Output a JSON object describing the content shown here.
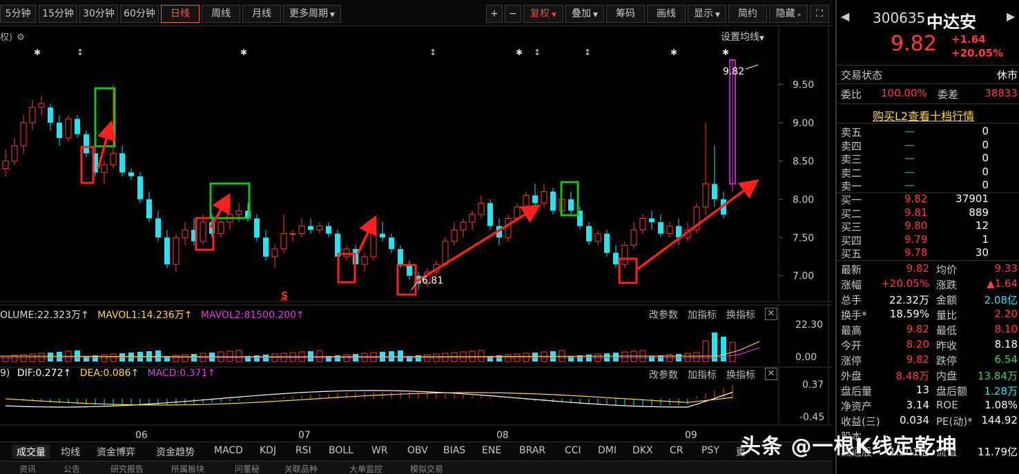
{
  "toolbar": {
    "periods": [
      "5分钟",
      "15分钟",
      "30分钟",
      "60分钟",
      "日线",
      "周线",
      "月线",
      "更多周期"
    ],
    "active_period": "日线",
    "plus": "+",
    "minus": "−",
    "fuquan": "复权",
    "overlay": "叠加",
    "chips": "筹码",
    "draw": "画线",
    "display": "显示",
    "simple": "简约",
    "hide": "隐藏",
    "fullscreen_icon": "fullscreen-icon"
  },
  "chart": {
    "left_label": "权)",
    "settings_label": "设置均线",
    "high_label": "9.82",
    "low_label": "6.81",
    "s_marker": "S",
    "markers": [
      "✱",
      "↕",
      "✱",
      "↕",
      "✱",
      "↕",
      "↕",
      "✱",
      "✱"
    ],
    "price_ticks": [
      "9.50",
      "9.00",
      "8.50",
      "8.00",
      "7.50",
      "7.00"
    ],
    "x_ticks": [
      "06",
      "07",
      "08",
      "09"
    ]
  },
  "chart_data": {
    "type": "candlestick",
    "price_axis": [
      6.7,
      9.9
    ],
    "ohlc": [
      [
        8.4,
        8.65,
        8.3,
        8.5
      ],
      [
        8.5,
        8.8,
        8.45,
        8.7
      ],
      [
        8.7,
        9.1,
        8.6,
        9.0
      ],
      [
        9.0,
        9.3,
        8.9,
        9.2
      ],
      [
        9.2,
        9.35,
        9.1,
        9.25
      ],
      [
        9.2,
        9.25,
        8.9,
        9.0
      ],
      [
        9.0,
        9.1,
        8.7,
        8.8
      ],
      [
        8.8,
        9.1,
        8.75,
        9.05
      ],
      [
        9.05,
        9.1,
        8.8,
        8.85
      ],
      [
        8.85,
        8.9,
        8.55,
        8.6
      ],
      [
        8.6,
        8.7,
        8.3,
        8.35
      ],
      [
        8.35,
        8.5,
        8.2,
        8.45
      ],
      [
        8.45,
        9.5,
        8.4,
        8.6
      ],
      [
        8.6,
        8.7,
        8.3,
        8.35
      ],
      [
        8.35,
        8.4,
        8.25,
        8.3
      ],
      [
        8.3,
        8.35,
        7.95,
        8.0
      ],
      [
        8.0,
        8.1,
        7.7,
        7.75
      ],
      [
        7.75,
        7.85,
        7.45,
        7.5
      ],
      [
        7.5,
        7.6,
        7.1,
        7.15
      ],
      [
        7.15,
        7.55,
        7.05,
        7.5
      ],
      [
        7.5,
        7.7,
        7.4,
        7.6
      ],
      [
        7.6,
        7.75,
        7.4,
        7.45
      ],
      [
        7.45,
        7.8,
        7.4,
        7.7
      ],
      [
        7.7,
        7.8,
        7.5,
        7.55
      ],
      [
        7.55,
        7.75,
        7.5,
        7.7
      ],
      [
        7.7,
        8.05,
        7.6,
        7.8
      ],
      [
        7.8,
        7.95,
        7.7,
        7.85
      ],
      [
        7.85,
        7.95,
        7.7,
        7.75
      ],
      [
        7.75,
        7.8,
        7.45,
        7.5
      ],
      [
        7.5,
        7.6,
        7.2,
        7.25
      ],
      [
        7.25,
        7.4,
        7.1,
        7.35
      ],
      [
        7.35,
        7.8,
        7.3,
        7.55
      ],
      [
        7.55,
        7.6,
        7.45,
        7.55
      ],
      [
        7.55,
        7.75,
        7.5,
        7.65
      ],
      [
        7.65,
        7.75,
        7.55,
        7.6
      ],
      [
        7.6,
        7.7,
        7.55,
        7.65
      ],
      [
        7.65,
        7.7,
        7.5,
        7.55
      ],
      [
        7.55,
        7.6,
        7.2,
        7.25
      ],
      [
        7.25,
        7.4,
        7.2,
        7.35
      ],
      [
        7.35,
        7.4,
        7.1,
        7.15
      ],
      [
        7.15,
        7.3,
        7.05,
        7.25
      ],
      [
        7.25,
        7.6,
        7.2,
        7.55
      ],
      [
        7.55,
        7.7,
        7.45,
        7.5
      ],
      [
        7.5,
        7.55,
        7.3,
        7.35
      ],
      [
        7.35,
        7.4,
        7.1,
        7.15
      ],
      [
        7.15,
        7.2,
        6.95,
        7.0
      ],
      [
        7.0,
        7.05,
        6.81,
        6.9
      ],
      [
        6.9,
        7.1,
        6.85,
        7.05
      ],
      [
        7.05,
        7.2,
        7.0,
        7.15
      ],
      [
        7.15,
        7.5,
        7.1,
        7.45
      ],
      [
        7.45,
        7.7,
        7.4,
        7.6
      ],
      [
        7.6,
        7.75,
        7.5,
        7.7
      ],
      [
        7.7,
        7.85,
        7.6,
        7.8
      ],
      [
        7.8,
        8.05,
        7.75,
        7.95
      ],
      [
        7.95,
        8.0,
        7.6,
        7.65
      ],
      [
        7.65,
        7.75,
        7.4,
        7.5
      ],
      [
        7.5,
        7.8,
        7.45,
        7.75
      ],
      [
        7.75,
        7.95,
        7.7,
        7.9
      ],
      [
        7.9,
        8.1,
        7.85,
        8.05
      ],
      [
        8.05,
        8.2,
        7.9,
        7.95
      ],
      [
        7.95,
        8.2,
        7.9,
        8.1
      ],
      [
        8.1,
        8.15,
        7.8,
        7.85
      ],
      [
        7.85,
        8.05,
        7.8,
        8.0
      ],
      [
        8.0,
        8.1,
        7.8,
        7.85
      ],
      [
        7.85,
        7.9,
        7.6,
        7.65
      ],
      [
        7.65,
        7.7,
        7.4,
        7.45
      ],
      [
        7.45,
        7.6,
        7.4,
        7.55
      ],
      [
        7.55,
        7.6,
        7.25,
        7.3
      ],
      [
        7.3,
        7.4,
        7.1,
        7.15
      ],
      [
        7.15,
        7.45,
        7.1,
        7.4
      ],
      [
        7.4,
        7.7,
        7.35,
        7.6
      ],
      [
        7.6,
        7.8,
        7.55,
        7.75
      ],
      [
        7.75,
        7.85,
        7.6,
        7.7
      ],
      [
        7.7,
        7.8,
        7.5,
        7.55
      ],
      [
        7.55,
        7.7,
        7.5,
        7.65
      ],
      [
        7.65,
        7.75,
        7.4,
        7.5
      ],
      [
        7.5,
        7.7,
        7.45,
        7.6
      ],
      [
        7.6,
        7.95,
        7.55,
        7.9
      ],
      [
        7.9,
        9.0,
        7.8,
        8.2
      ],
      [
        8.2,
        8.7,
        7.9,
        8.0
      ],
      [
        8.0,
        8.1,
        7.75,
        7.8
      ],
      [
        8.2,
        9.82,
        8.1,
        9.82
      ]
    ],
    "volume_axis": [
      "22.30",
      "0.00"
    ],
    "macd_axis": [
      "0.37",
      "-0.45"
    ]
  },
  "volume": {
    "label": "OLUME:22.323万↑",
    "mavol1": "MAVOL1:14.236万↑",
    "mavol2": "MAVOL2:81500.200↑",
    "tools": [
      "改参数",
      "加指标",
      "换指标"
    ]
  },
  "macd": {
    "label": "9)",
    "dif": "DIF:0.272↑",
    "dea": "DEA:0.086↑",
    "macd": "MACD:0.371↑",
    "tools": [
      "改参数",
      "加指标",
      "换指标"
    ]
  },
  "tabs": [
    "成交量",
    "均线",
    "资金博弈",
    "资金趋势",
    "MACD",
    "KDJ",
    "RSI",
    "BOLL",
    "WR",
    "OBV",
    "BIAS",
    "ENE",
    "BRAR",
    "CCI",
    "DMI",
    "DKX",
    "CR",
    "PSY",
    "更"
  ],
  "tabs2": [
    "资讯",
    "公告",
    "研究报告",
    "所属板块",
    "问董秘",
    "关联品种",
    "大单监控",
    "模拟交易"
  ],
  "quote": {
    "code": "300635",
    "name": "中达安",
    "price": "9.82",
    "change": "+1.64",
    "change_pct": "+20.05%",
    "status_label": "交易状态",
    "status_value": "休市",
    "weibi_label": "委比",
    "weibi_value": "100.00%",
    "weicha_label": "委差",
    "weicha_value": "38833",
    "l2_link": "购买L2查看十档行情",
    "asks": [
      {
        "label": "卖五",
        "price": "—",
        "vol": "0"
      },
      {
        "label": "卖四",
        "price": "—",
        "vol": "0"
      },
      {
        "label": "卖三",
        "price": "—",
        "vol": "0"
      },
      {
        "label": "卖二",
        "price": "—",
        "vol": "0"
      },
      {
        "label": "卖一",
        "price": "—",
        "vol": "0"
      }
    ],
    "bids": [
      {
        "label": "买一",
        "price": "9.82",
        "vol": "37901"
      },
      {
        "label": "买二",
        "price": "9.81",
        "vol": "889"
      },
      {
        "label": "买三",
        "price": "9.80",
        "vol": "12"
      },
      {
        "label": "买四",
        "price": "9.79",
        "vol": "1"
      },
      {
        "label": "买五",
        "price": "9.78",
        "vol": "30"
      }
    ],
    "stats": [
      {
        "l1": "最新",
        "v1": "9.82",
        "c1": "red",
        "l2": "均价",
        "v2": "9.33",
        "c2": "red"
      },
      {
        "l1": "涨幅",
        "v1": "+20.05%",
        "c1": "red",
        "l2": "涨跌",
        "v2": "▲1.64",
        "c2": "red"
      },
      {
        "l1": "总手",
        "v1": "22.32万",
        "c1": "white",
        "l2": "金额",
        "v2": "2.08亿",
        "c2": "cyan"
      },
      {
        "l1": "换手*",
        "v1": "18.59%",
        "c1": "white",
        "l2": "量比",
        "v2": "2.20",
        "c2": "red"
      },
      {
        "l1": "最高",
        "v1": "9.82",
        "c1": "red",
        "l2": "最低",
        "v2": "8.10",
        "c2": "red"
      },
      {
        "l1": "今开",
        "v1": "8.20",
        "c1": "red",
        "l2": "昨收",
        "v2": "8.18",
        "c2": "white"
      },
      {
        "l1": "涨停",
        "v1": "9.82",
        "c1": "red",
        "l2": "跌停",
        "v2": "6.54",
        "c2": "green"
      },
      {
        "l1": "外盘",
        "v1": "8.48万",
        "c1": "red",
        "l2": "内盘",
        "v2": "13.84万",
        "c2": "green"
      },
      {
        "l1": "盘后量",
        "v1": "13",
        "c1": "white",
        "l2": "盘后额",
        "v2": "1.28万",
        "c2": "cyan"
      },
      {
        "l1": "净资产",
        "v1": "3.14",
        "c1": "white",
        "l2": "ROE",
        "v2": "1.08%",
        "c2": "white"
      },
      {
        "l1": "收益(三)",
        "v1": "0.034",
        "c1": "white",
        "l2": "PE(动)*",
        "v2": "144.92",
        "c2": "white"
      },
      {
        "l1": "股本",
        "v1": "",
        "c1": "white",
        "l2": "",
        "v2": "",
        "c2": "white"
      },
      {
        "l1": "流通股",
        "v1": "1.201亿",
        "c1": "white",
        "l2": "流值",
        "v2": "11.79亿",
        "c2": "white"
      }
    ]
  },
  "watermark": "头条 @一根K线定乾坤",
  "colors": {
    "up": "#ff3c3c",
    "down": "#25e4f0",
    "annot_red": "#ff2020",
    "annot_green": "#18c018"
  }
}
